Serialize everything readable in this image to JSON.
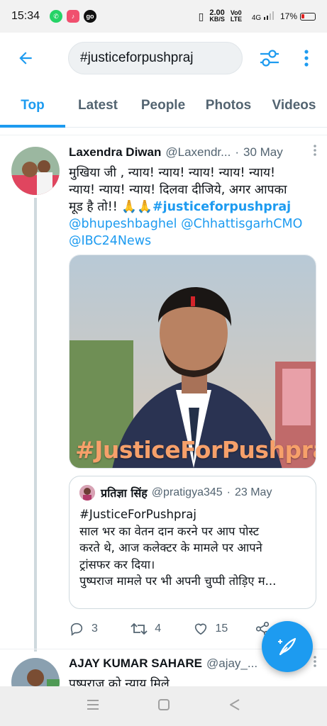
{
  "status_bar": {
    "time": "15:34",
    "network_speed_value": "2.00",
    "network_speed_unit": "KB/S",
    "volte": "Vo0 LTE",
    "signal_label": "4G",
    "battery_percent": "17%"
  },
  "search": {
    "query": "#justiceforpushpraj"
  },
  "tabs": [
    {
      "label": "Top",
      "active": true
    },
    {
      "label": "Latest",
      "active": false
    },
    {
      "label": "People",
      "active": false
    },
    {
      "label": "Photos",
      "active": false
    },
    {
      "label": "Videos",
      "active": false
    }
  ],
  "tweet": {
    "author_name": "Laxendra Diwan",
    "author_handle": "@Laxendr...",
    "separator": "·",
    "date": "30 May",
    "text_line1": "मुखिया जी , न्याय! न्याय! न्याय! न्याय! न्याय!",
    "text_line2": "न्याय! न्याय! न्याय! दिलवा दीजिये, अगर आपका",
    "text_line3_prefix": "मूड है तो!! 🙏🙏",
    "hashtag": "#justiceforpushpraj",
    "mention1": "@bhupeshbaghel",
    "mention2": "@ChhattisgarhCMO",
    "mention3": "@IBC24News",
    "media_caption": "#JusticeForPushpraj",
    "quote": {
      "name": "प्रतिज्ञा सिंह",
      "handle": "@pratigya345",
      "separator": "·",
      "date": "23 May",
      "line1": "#JusticeForPushpraj",
      "line2": "साल भर का वेतन दान करने पर आप पोस्ट",
      "line3": "करते थे, आज कलेक्टर के मामले पर आपने",
      "line4": "ट्रांसफर कर दिया।",
      "line5": "पुष्पराज मामले पर भी अपनी चुप्पी तोड़िए म..."
    },
    "replies": "3",
    "retweets": "4",
    "likes": "15"
  },
  "tweet2": {
    "author_name": "AJAY KUMAR SAHARE",
    "author_handle": "@ajay_...",
    "text_line1": "पुष्पराज को न्याय मिले"
  },
  "colors": {
    "accent": "#1d9bf0",
    "secondary_text": "#536471",
    "caption_orange": "#f6a06a"
  },
  "icons": [
    "back-arrow-icon",
    "filter-sliders-icon",
    "more-vertical-icon",
    "reply-icon",
    "retweet-icon",
    "like-icon",
    "share-icon",
    "compose-feather-icon",
    "nav-menu-icon",
    "nav-home-icon",
    "nav-back-icon"
  ]
}
